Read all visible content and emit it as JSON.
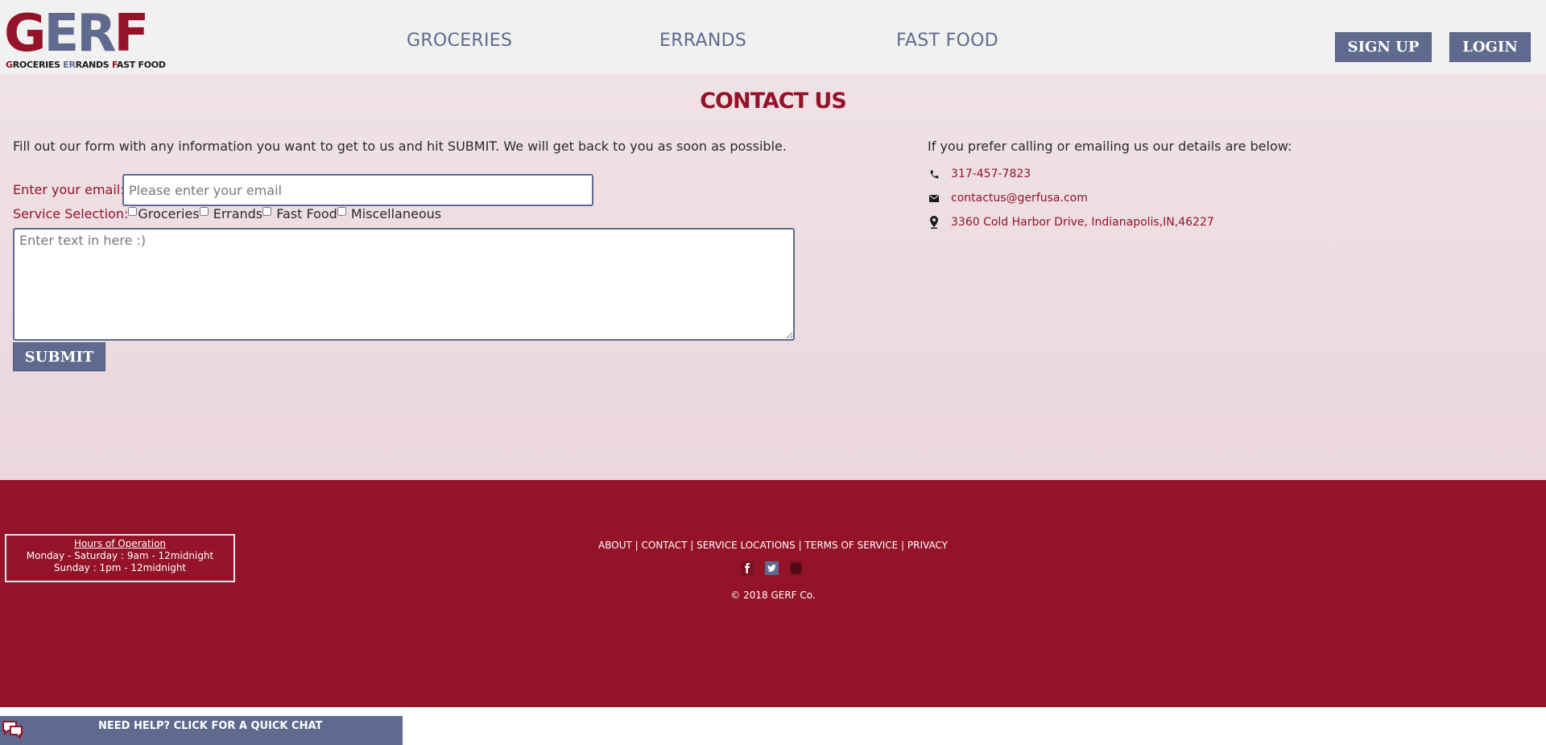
{
  "header": {
    "logo": {
      "letters": [
        {
          "char": "G",
          "color": "red"
        },
        {
          "char": "E",
          "color": "blue"
        },
        {
          "char": "R",
          "color": "blue"
        },
        {
          "char": "F",
          "color": "red"
        }
      ],
      "tagline": [
        {
          "text": "G",
          "style": "accent"
        },
        {
          "text": "ROCERIES ",
          "style": "plain"
        },
        {
          "text": "ER",
          "style": "accent-b"
        },
        {
          "text": "RANDS ",
          "style": "plain"
        },
        {
          "text": "F",
          "style": "accent"
        },
        {
          "text": "AST FOOD",
          "style": "plain"
        }
      ]
    },
    "nav": {
      "groceries": "GROCERIES",
      "errands": "ERRANDS",
      "fast_food": "FAST FOOD"
    },
    "signup_label": "SIGN UP",
    "login_label": "LOGIN"
  },
  "main": {
    "title": "CONTACT US",
    "intro": "Fill out our form with any information you want to get to us and hit SUBMIT. We will get back to you as soon as possible.",
    "email_label": "Enter your email:",
    "email_placeholder": "Please enter your email",
    "email_value": "",
    "service_label": "Service Selection:",
    "services": {
      "groceries": "Groceries",
      "errands": "Errands",
      "fast_food": "Fast Food",
      "misc": "Miscellaneous"
    },
    "message_placeholder": "Enter text in here :)",
    "message_value": "",
    "submit_label": "SUBMIT",
    "contact_intro": "If you prefer calling or emailing us our details are below:",
    "contact": {
      "phone": {
        "icon": "phone-icon",
        "text": "317-457-7823"
      },
      "email": {
        "icon": "envelope-icon",
        "text": "contactus@gerfusa.com"
      },
      "address": {
        "icon": "map-pin-icon",
        "text": "3360 Cold Harbor Drive, Indianapolis,IN,46227"
      }
    }
  },
  "footer": {
    "hours_title": "Hours of Operation",
    "hours_weekday": "Monday - Saturday : 9am - 12midnight",
    "hours_sunday": "Sunday : 1pm - 12midnight",
    "links": {
      "about": "ABOUT",
      "contact": "CONTACT",
      "locations": "SERVICE LOCATIONS",
      "terms": "TERMS OF SERVICE",
      "privacy": "PRIVACY"
    },
    "separator": " | ",
    "social": [
      "facebook-icon",
      "twitter-icon",
      "instagram-icon"
    ],
    "copyright": "© 2018 GERF Co."
  },
  "chat": {
    "label": "NEED HELP? CLICK FOR A QUICK CHAT",
    "icon": "chat-bubbles-icon"
  },
  "colors": {
    "brand_red": "#941328",
    "brand_blue": "#5f6a8e",
    "header_bg": "#f1f1f1",
    "main_bg": "#efe2e6"
  }
}
